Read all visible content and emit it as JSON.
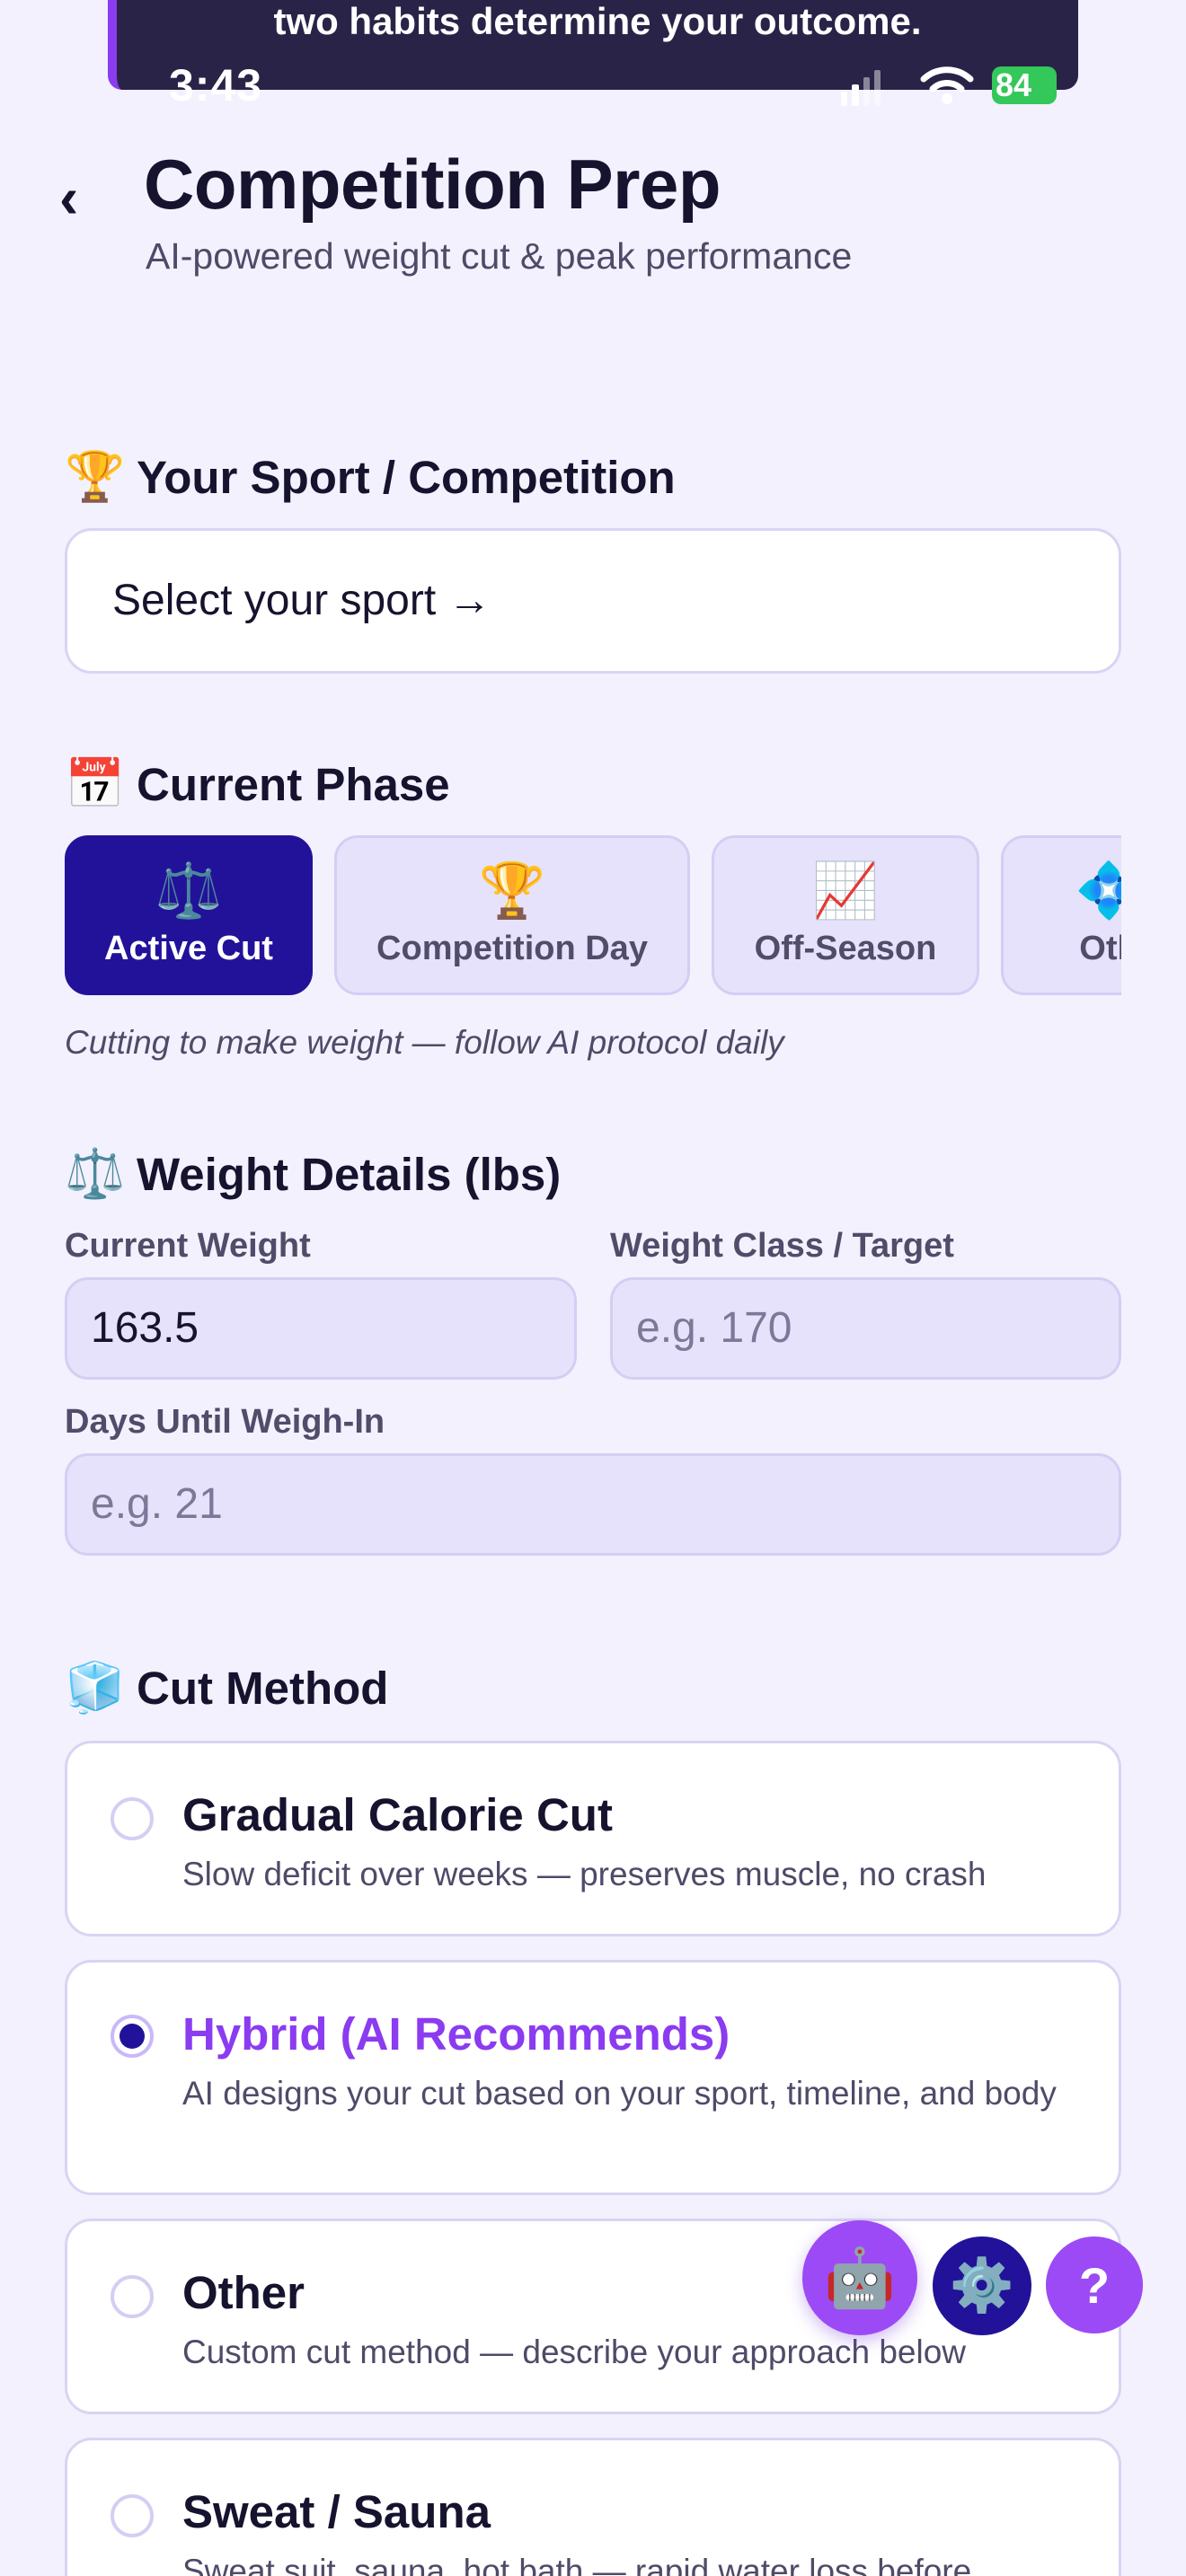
{
  "banner": {
    "text": "two habits determine your outcome."
  },
  "status_bar": {
    "time": "3:43",
    "battery": "84"
  },
  "header": {
    "back_icon": "chevron-left-icon",
    "title": "Competition Prep",
    "subtitle": "AI-powered weight cut & peak performance"
  },
  "sport_section": {
    "icon": "trophy-icon",
    "heading": "Your Sport / Competition",
    "select_label": "Select your sport →"
  },
  "phase_section": {
    "icon": "calendar-icon",
    "heading": "Current Phase",
    "chips": [
      {
        "label": "Active Cut",
        "icon": "⚖️",
        "active": true
      },
      {
        "label": "Competition Day",
        "icon": "🏆",
        "active": false
      },
      {
        "label": "Off-Season",
        "icon": "📈",
        "active": false
      },
      {
        "label": "Oth",
        "icon": "💠",
        "active": false
      }
    ],
    "note": "Cutting to make weight — follow AI protocol daily"
  },
  "weight_section": {
    "icon": "scale-icon",
    "heading": "Weight Details (lbs)",
    "current_weight_label": "Current Weight",
    "current_weight_value": "163.5",
    "target_label": "Weight Class / Target",
    "target_placeholder": "e.g. 170",
    "days_label": "Days Until Weigh-In",
    "days_placeholder": "e.g. 21"
  },
  "cut_method_section": {
    "icon": "ice-cube-icon",
    "heading": "Cut Method",
    "options": [
      {
        "title": "Gradual Calorie Cut",
        "desc": "Slow deficit over weeks — preserves muscle, no crash",
        "selected": false
      },
      {
        "title": "Hybrid (AI Recommends)",
        "desc": "AI designs your cut based on your sport, timeline, and body",
        "selected": true
      },
      {
        "title": "Other",
        "desc": "Custom cut method — describe your approach below",
        "selected": false
      },
      {
        "title": "Sweat / Sauna",
        "desc": "Sweat suit, sauna, hot bath — rapid water loss before",
        "selected": false
      }
    ]
  },
  "floating_buttons": {
    "assistant_icon": "robot-icon",
    "settings_icon": "gear-icon",
    "help_label": "?"
  },
  "colors": {
    "background": "#f3f1fd",
    "primary": "#22129a",
    "accent": "#8b3bf0",
    "chip_bg": "#e6e2fb"
  }
}
